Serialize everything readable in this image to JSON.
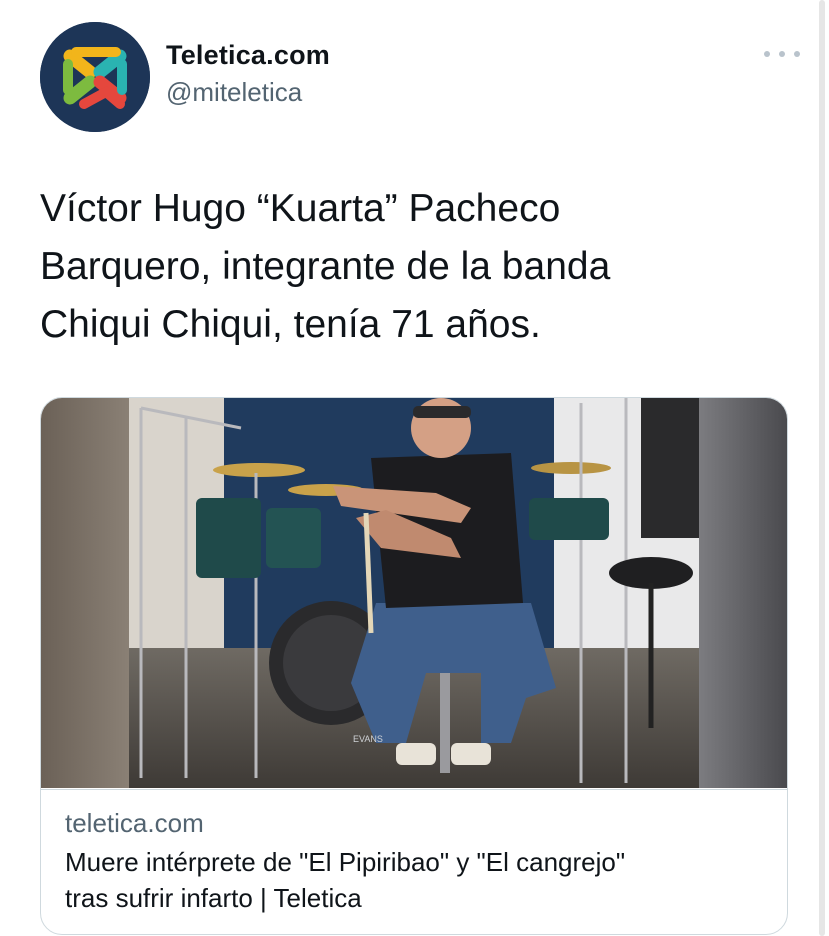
{
  "account": {
    "display_name": "Teletica.com",
    "handle": "@miteletica"
  },
  "tweet": {
    "text_lines": [
      "Víctor Hugo “Kuarta” Pacheco",
      "Barquero, integrante de la banda",
      "Chiqui Chiqui, tenía 71 años."
    ]
  },
  "card": {
    "domain": "teletica.com",
    "title_lines": [
      "Muere intérprete de \"El Pipiribao\" y \"El cangrejo\"",
      "tras sufrir infarto | Teletica"
    ],
    "image_logo_text": "EVANS"
  },
  "colors": {
    "avatar_bg": "#1d3557",
    "logo_yellow": "#f2b51b",
    "logo_green": "#7dbb3f",
    "logo_teal": "#2ab3b1",
    "logo_red": "#e5473d",
    "secondary_text": "#536471"
  },
  "icons": {
    "more": "more-horizontal-icon",
    "logo": "teletica-x-logo"
  }
}
